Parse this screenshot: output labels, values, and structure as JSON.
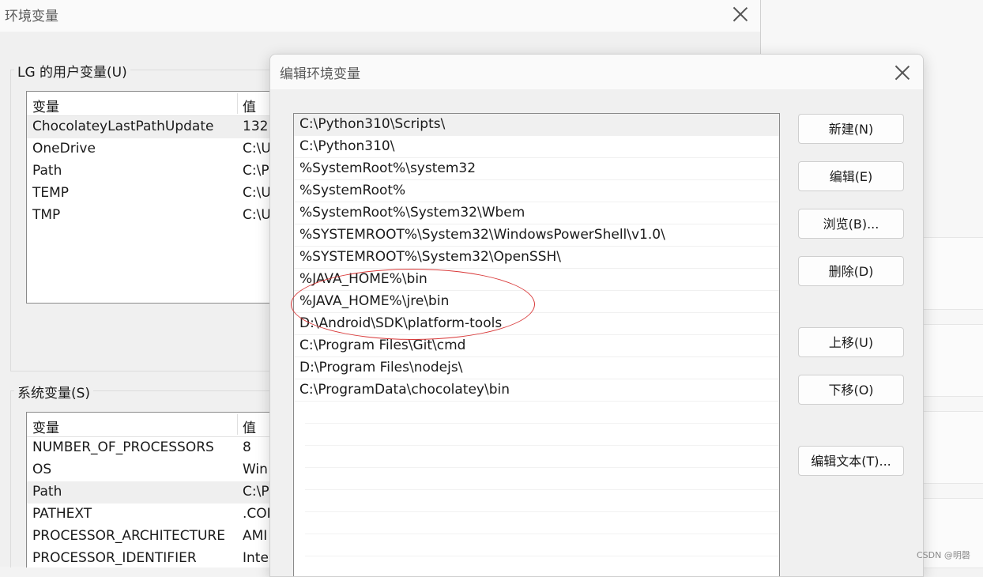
{
  "background_window": {
    "title": "环境变量",
    "user_vars": {
      "group_label": "LG 的用户变量(U)",
      "headers": {
        "name": "变量",
        "value": "值"
      },
      "rows": [
        {
          "name": "ChocolateyLastPathUpdate",
          "value": "132!"
        },
        {
          "name": "OneDrive",
          "value": "C:\\U"
        },
        {
          "name": "Path",
          "value": "C:\\P"
        },
        {
          "name": "TEMP",
          "value": "C:\\U"
        },
        {
          "name": "TMP",
          "value": "C:\\U"
        }
      ]
    },
    "system_vars": {
      "group_label": "系统变量(S)",
      "headers": {
        "name": "变量",
        "value": "值"
      },
      "rows": [
        {
          "name": "NUMBER_OF_PROCESSORS",
          "value": "8"
        },
        {
          "name": "OS",
          "value": "Win"
        },
        {
          "name": "Path",
          "value": "C:\\P"
        },
        {
          "name": "PATHEXT",
          "value": ".COI"
        },
        {
          "name": "PROCESSOR_ARCHITECTURE",
          "value": "AMI"
        },
        {
          "name": "PROCESSOR_IDENTIFIER",
          "value": "Inte"
        }
      ]
    }
  },
  "dialog": {
    "title": "编辑环境变量",
    "paths": [
      "C:\\Python310\\Scripts\\",
      "C:\\Python310\\",
      "%SystemRoot%\\system32",
      "%SystemRoot%",
      "%SystemRoot%\\System32\\Wbem",
      "%SYSTEMROOT%\\System32\\WindowsPowerShell\\v1.0\\",
      "%SYSTEMROOT%\\System32\\OpenSSH\\",
      "%JAVA_HOME%\\bin",
      "%JAVA_HOME%\\jre\\bin",
      "D:\\Android\\SDK\\platform-tools",
      "C:\\Program Files\\Git\\cmd",
      "D:\\Program Files\\nodejs\\",
      "C:\\ProgramData\\chocolatey\\bin"
    ],
    "buttons": {
      "new": "新建(N)",
      "edit": "编辑(E)",
      "browse": "浏览(B)...",
      "delete": "删除(D)",
      "move_up": "上移(U)",
      "move_down": "下移(O)",
      "edit_text": "编辑文本(T)..."
    }
  },
  "watermark": "CSDN @明磬",
  "colors": {
    "annotation": "#d93a3a",
    "selection": "#f0f0f0"
  }
}
